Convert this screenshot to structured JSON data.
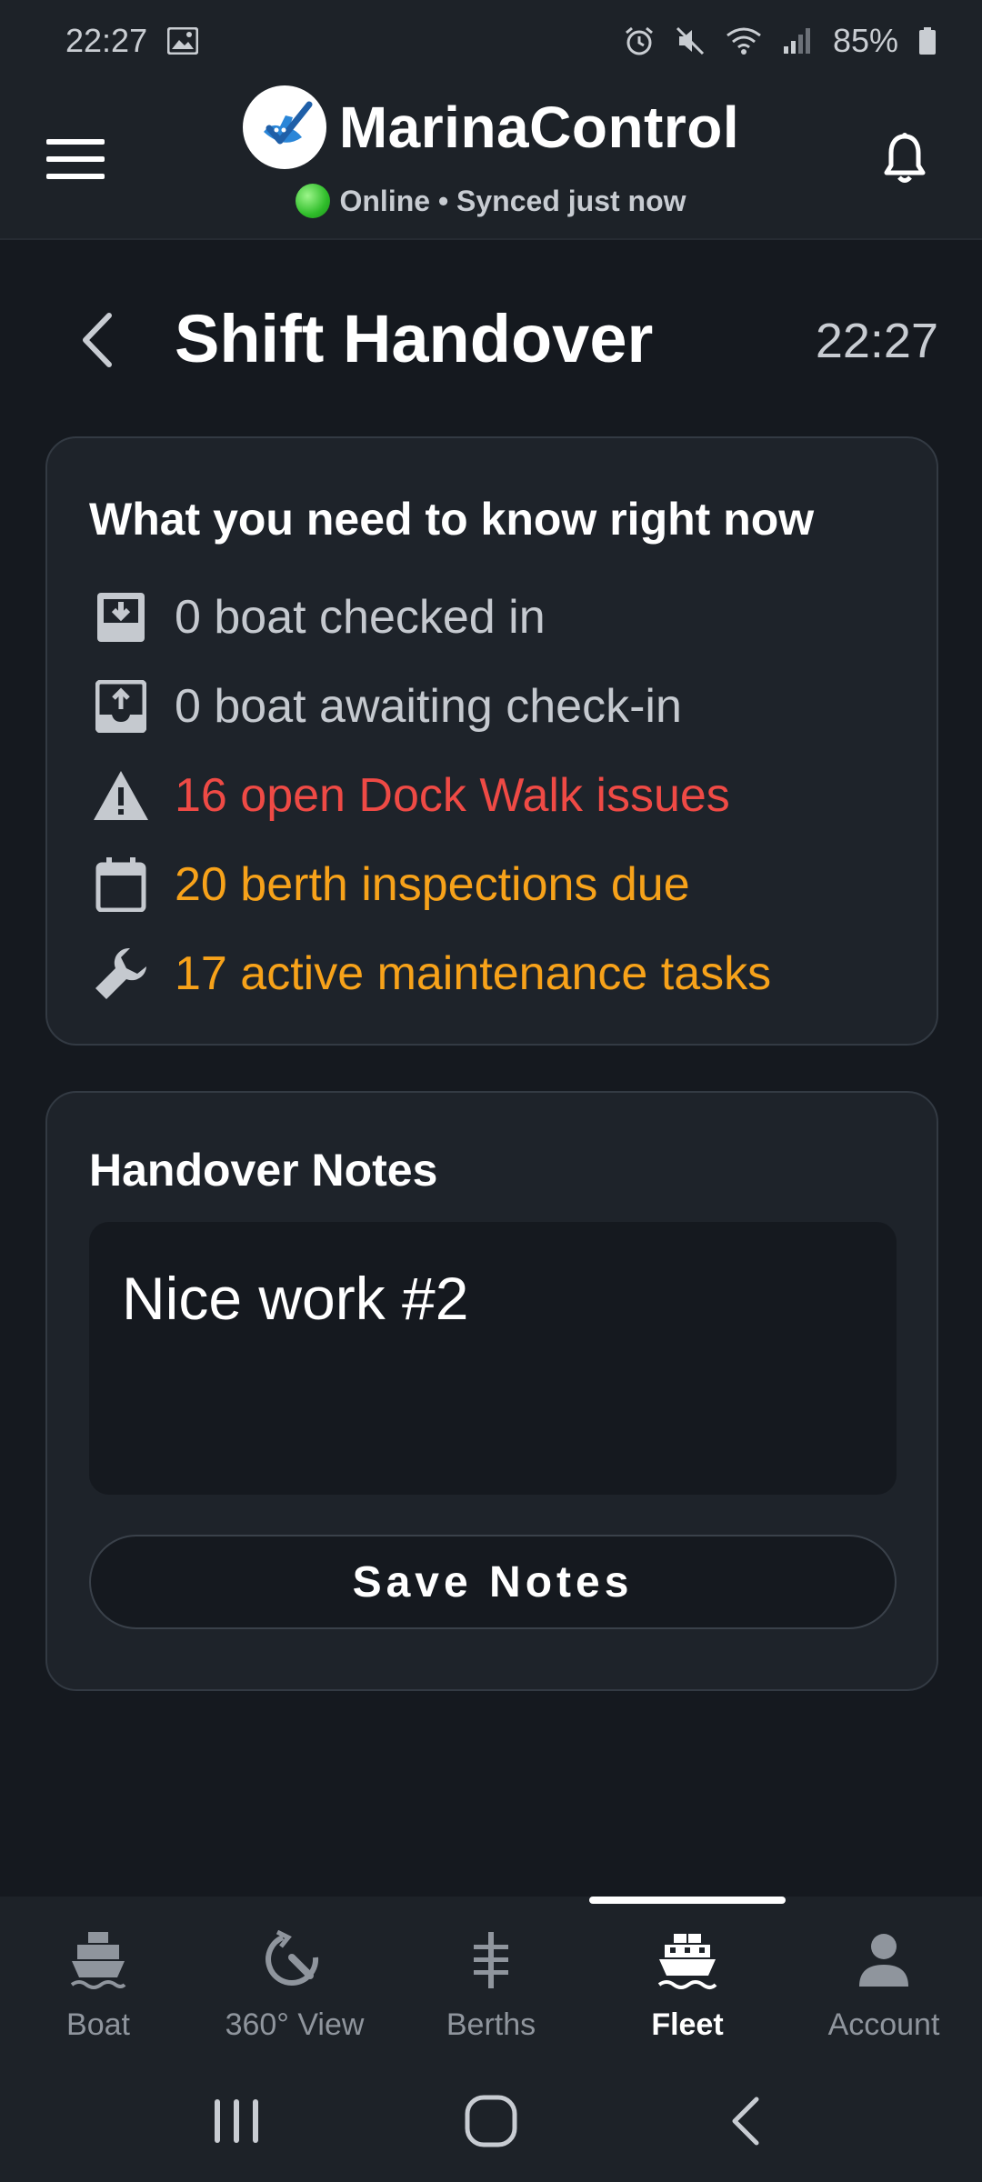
{
  "status_bar": {
    "time": "22:27",
    "battery": "85%"
  },
  "header": {
    "app_name": "MarinaControl",
    "sync_status": "Online • Synced just now"
  },
  "page": {
    "title": "Shift Handover",
    "time": "22:27"
  },
  "summary": {
    "heading": "What you need to know right now",
    "items": [
      {
        "icon": "inbox-download-icon",
        "text": "0 boat checked in",
        "color": "#c5c9cf"
      },
      {
        "icon": "inbox-upload-icon",
        "text": "0 boat awaiting check-in",
        "color": "#c5c9cf"
      },
      {
        "icon": "warning-icon",
        "text": "16 open Dock Walk issues",
        "color": "#ef4a45"
      },
      {
        "icon": "calendar-icon",
        "text": "20 berth inspections due",
        "color": "#f7a21a"
      },
      {
        "icon": "wrench-icon",
        "text": "17 active maintenance tasks",
        "color": "#f7a21a"
      }
    ]
  },
  "notes": {
    "heading": "Handover Notes",
    "value": "Nice work #2",
    "save_label": "Save Notes"
  },
  "bottom_nav": {
    "active": "Fleet",
    "items": [
      {
        "icon": "boat-icon",
        "label": "Boat"
      },
      {
        "icon": "360-view-icon",
        "label": "360° View"
      },
      {
        "icon": "berths-icon",
        "label": "Berths"
      },
      {
        "icon": "fleet-icon",
        "label": "Fleet"
      },
      {
        "icon": "account-icon",
        "label": "Account"
      }
    ]
  },
  "colors": {
    "background": "#15191f",
    "surface": "#1e232a",
    "danger": "#ef4a45",
    "warning": "#f7a21a",
    "online": "#2fbd2a"
  }
}
